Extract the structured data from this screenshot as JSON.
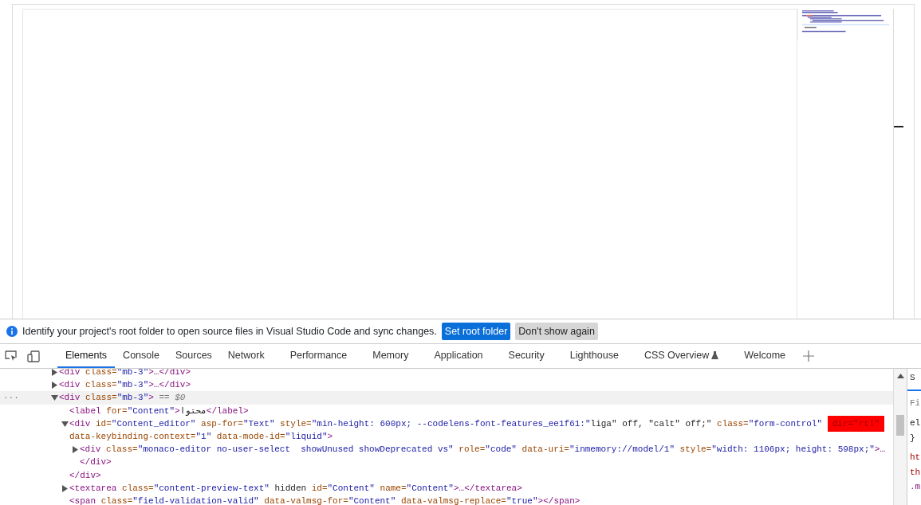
{
  "infobar": {
    "message": "Identify your project's root folder to open source files in Visual Studio Code and sync changes.",
    "buttons": [
      {
        "label": "Set root folder",
        "kind": "primary"
      },
      {
        "label": "Don't show again",
        "kind": "secondary"
      }
    ]
  },
  "tabs": [
    {
      "label": "Elements",
      "selected": true
    },
    {
      "label": "Console",
      "selected": false
    },
    {
      "label": "Sources",
      "selected": false
    },
    {
      "label": "Network",
      "selected": false
    },
    {
      "label": "Performance",
      "selected": false
    },
    {
      "label": "Memory",
      "selected": false
    },
    {
      "label": "Application",
      "selected": false
    },
    {
      "label": "Security",
      "selected": false
    },
    {
      "label": "Lighthouse",
      "selected": false
    },
    {
      "label": "CSS Overview",
      "selected": false,
      "experimental": true
    },
    {
      "label": "Welcome",
      "selected": false
    }
  ],
  "dom_tree": [
    {
      "text": "<div class=\"mb-3\">…</div>",
      "expanded": false,
      "selected": false
    },
    {
      "text": "<div class=\"mb-3\">…</div>",
      "expanded": false,
      "selected": false
    },
    {
      "text": "<div class=\"mb-3\">",
      "suffix": "== $0",
      "row_menu": "···",
      "expanded": true,
      "selected": true,
      "children": [
        {
          "text": "<label for=\"Content\">محتوا</label>",
          "selected": false
        },
        {
          "text": "<div id=\"Content_editor\" asp-for=\"Text\" style=\"min-height: 600px; --codelens-font-features_ee1f61:\"liga\" off, \"calt\" off;\" class=\"form-control\"",
          "flagged": "dir=\"rtl\"",
          "continuation": "data-keybinding-context=\"1\" data-mode-id=\"liquid\">",
          "expanded": true,
          "selected": false,
          "children": [
            {
              "text": "<div class=\"monaco-editor no-user-select  showUnused showDeprecated vs\" role=\"code\" data-uri=\"inmemory://model/1\" style=\"width: 1106px; height: 598px;\">…",
              "expanded": false,
              "selected": false
            },
            {
              "text": "</div>",
              "selected": false
            }
          ]
        },
        {
          "text": "</div>",
          "selected": false
        },
        {
          "text": "<textarea class=\"content-preview-text\" hidden id=\"Content\" name=\"Content\">…</textarea>",
          "expanded": false,
          "selected": false
        },
        {
          "text": "<span class=\"field-validation-valid\" data-valmsg-for=\"Content\" data-valmsg-replace=\"true\"></span>",
          "selected": false
        }
      ]
    }
  ],
  "styles_pane": {
    "tab": "S",
    "filter_placeholder": "Fi",
    "lines": [
      {
        "text": "el",
        "kind": "selector"
      },
      {
        "text": "}",
        "kind": "brace"
      },
      {
        "text": "ht",
        "kind": "source"
      },
      {
        "text": "th",
        "kind": "source"
      },
      {
        "text": ".m",
        "kind": "rule"
      }
    ]
  }
}
